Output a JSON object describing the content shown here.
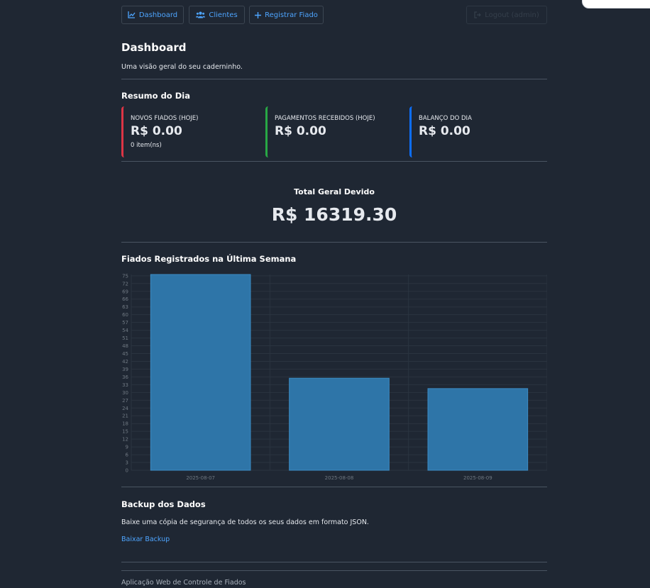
{
  "nav": {
    "dashboard_label": "Dashboard",
    "clients_label": "Clientes",
    "register_label": "Registrar Fiado",
    "logout_label": "Logout (admin)"
  },
  "header": {
    "title": "Dashboard",
    "subtitle": "Uma visão geral do seu caderninho."
  },
  "summary": {
    "title": "Resumo do Dia",
    "cards": [
      {
        "label": "NOVOS FIADOS (HOJE)",
        "value": "R$ 0.00",
        "sub": "0 item(ns)",
        "color": "#dc3545"
      },
      {
        "label": "PAGAMENTOS RECEBIDOS (HOJE)",
        "value": "R$ 0.00",
        "color": "#28a745"
      },
      {
        "label": "BALANÇO DO DIA",
        "value": "R$ 0.00",
        "color": "#0d6efd"
      }
    ]
  },
  "total": {
    "title": "Total Geral Devido",
    "value": "R$ 16319.30"
  },
  "chart_section": {
    "title": "Fiados Registrados na Última Semana"
  },
  "chart_data": {
    "type": "bar",
    "categories": [
      "2025-08-07",
      "2025-08-08",
      "2025-08-09"
    ],
    "values": [
      75.5,
      35.5,
      31.5
    ],
    "ylim": [
      0,
      75.5
    ],
    "yticks": [
      0,
      3,
      6,
      9,
      12,
      15,
      18,
      21,
      24,
      27,
      30,
      33,
      36,
      39,
      42,
      45,
      48,
      51,
      54,
      57,
      60,
      63,
      66,
      69,
      72,
      75
    ],
    "grid": true,
    "legend": "none",
    "bar_color": "#2e75a8"
  },
  "backup": {
    "title": "Backup dos Dados",
    "text": "Baixe uma cópia de segurança de todos os seus dados em formato JSON.",
    "link_label": "Baixar Backup"
  },
  "footer": {
    "text": "Aplicação Web de Controle de Fiados"
  }
}
